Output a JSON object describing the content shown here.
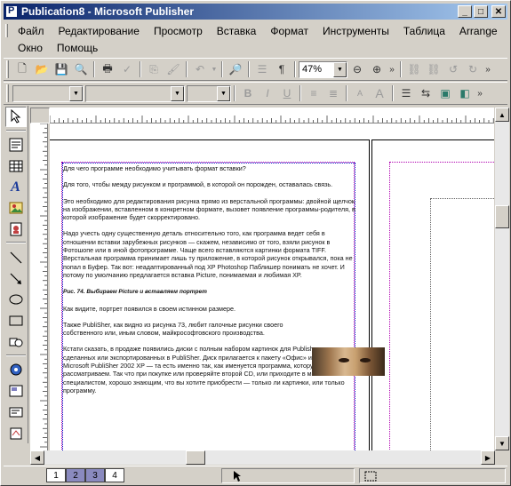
{
  "window": {
    "title": "Publication8 - Microsoft Publisher"
  },
  "menu": {
    "row1": [
      "Файл",
      "Редактирование",
      "Просмотр",
      "Вставка",
      "Формат",
      "Инструменты",
      "Таблица",
      "Arrange"
    ],
    "row2": [
      "Окно",
      "Помощь"
    ]
  },
  "standard_toolbar": {
    "zoom": "47%"
  },
  "formatting_toolbar": {
    "style": "",
    "font": "",
    "size": ""
  },
  "document": {
    "paragraphs": [
      "Для чего программе необходимо учитывать формат вставки?",
      "Для того, чтобы между рисунком и программой, в которой он порожден, оставалась связь.",
      "Это необходимо для редактирования рисунка прямо из верстальной программы: двойной щелчок на изображении, вставленном в конкретном формате, вызовет появление программы-родителя, в которой изображение будет скорректировано.",
      "Надо учесть одну существенную деталь относительно того, как программа ведет себя в отношении вставки зарубежных рисунков — скажем, независимо от того, взяли рисунок в Фотошопе или в иной фотопрограмме. Чаще всего вставляются картинки формата TIFF. Верстальная программа принимает лишь ту приложение, в которой рисунок открывался, пока не попал в Буфер. Так вот: неадаптированный под XP Photoshop Паблишер понимать не хочет. И потому по умолчанию предлагается вставка Picture, понимаемая и любимая XP.",
      "Как видите, портрет появился в своем истинном размере.",
      "Также PubliSher, как видно из рисунка 73, любит галочные рисунки своего собственного или, иным словом, майкрософтовского производства.",
      "Кстати сказать, в продаже появились диски с полным набором картинок для Publisher и сделанных или экспортированных в PubliSher. Диск прилагается к пакету «Офис» и называется Microsoft PubliSher 2002 XP — та есть именно так, как именуется программа, которую мы рассматриваем. Так что при покупке или проверяйте второй CD, или приходите в магазин со специалистом, хорошо знающим, что вы хотите приобрести — только ли картинки, или только программу."
    ],
    "caption": "Рис. 74. Выбираем Picture и вставляем портрет"
  },
  "status": {
    "pages": [
      "1",
      "2",
      "3",
      "4"
    ],
    "selected_pages": [
      "2",
      "3"
    ]
  }
}
